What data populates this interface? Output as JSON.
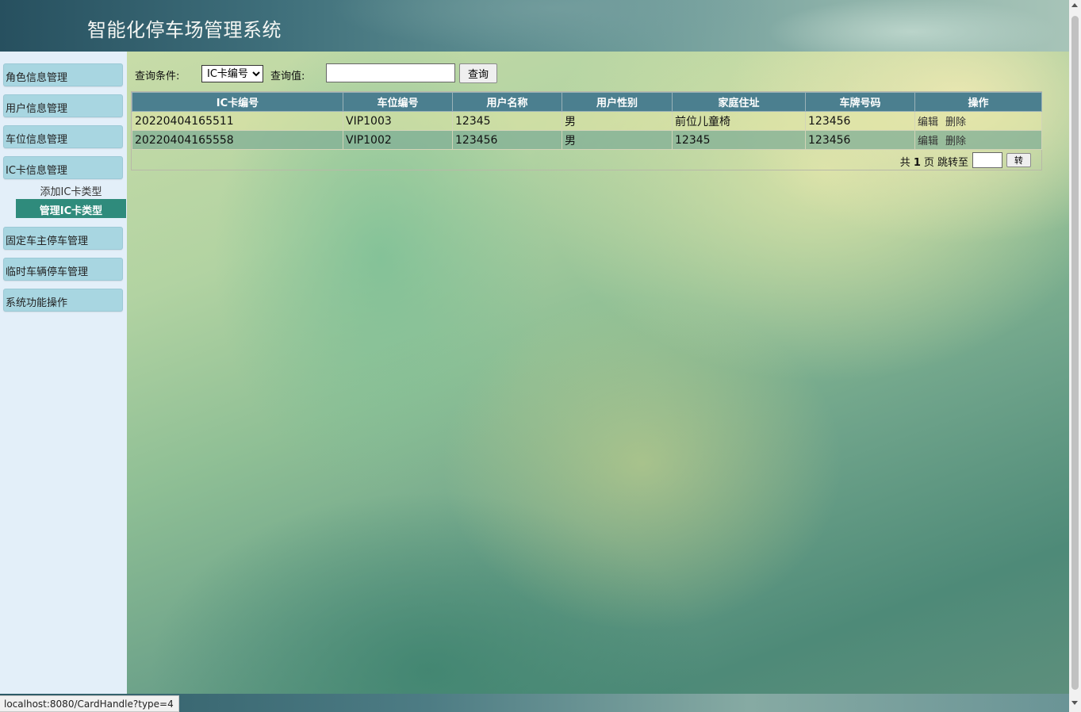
{
  "app": {
    "title": "智能化停车场管理系统"
  },
  "sidebar": {
    "items": [
      {
        "label": "角色信息管理"
      },
      {
        "label": "用户信息管理"
      },
      {
        "label": "车位信息管理"
      },
      {
        "label": "IC卡信息管理"
      },
      {
        "label": "固定车主停车管理"
      },
      {
        "label": "临时车辆停车管理"
      },
      {
        "label": "系统功能操作"
      }
    ],
    "subitems": [
      {
        "label": "添加IC卡类型"
      },
      {
        "label": "管理IC卡类型",
        "active": true
      }
    ]
  },
  "search": {
    "condition_label": "查询条件:",
    "condition_value": "IC卡编号",
    "value_label": "查询值:",
    "value": "",
    "button_label": "查询"
  },
  "table": {
    "headers": [
      "IC卡编号",
      "车位编号",
      "用户名称",
      "用户性别",
      "家庭住址",
      "车牌号码",
      "操作"
    ],
    "rows": [
      [
        "20220404165511",
        "VIP1003",
        "12345",
        "男",
        "前位儿童椅",
        "123456"
      ],
      [
        "20220404165558",
        "VIP1002",
        "123456",
        "男",
        "12345",
        "123456"
      ]
    ],
    "actions": {
      "edit": "编辑",
      "delete": "删除"
    }
  },
  "pager": {
    "prefix": "共",
    "total_pages": "1",
    "suffix": "页 跳转至",
    "go_label": "转"
  },
  "status_bar": {
    "url": "localhost:8080/CardHandle?type=4"
  }
}
